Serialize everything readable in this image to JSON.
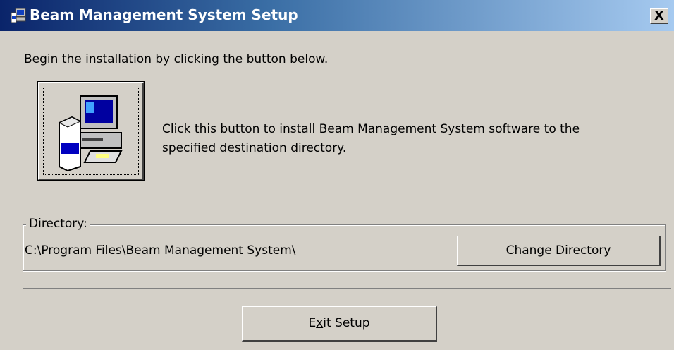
{
  "window": {
    "title": "Beam Management System Setup",
    "close_label": "X"
  },
  "intro_text": "Begin the installation by clicking the button below.",
  "install": {
    "icon": "setup-computer-icon",
    "description": "Click this button to install Beam Management System software to the specified destination directory."
  },
  "directory": {
    "label": "Directory:",
    "path": "C:\\Program Files\\Beam Management System\\",
    "change_button_prefix": "",
    "change_button_mnemonic": "C",
    "change_button_suffix": "hange Directory"
  },
  "exit": {
    "prefix": "E",
    "mnemonic": "x",
    "suffix": "it Setup"
  },
  "colors": {
    "face": "#d4d0c8",
    "title_start": "#0a246a",
    "title_end": "#a6caf0"
  }
}
